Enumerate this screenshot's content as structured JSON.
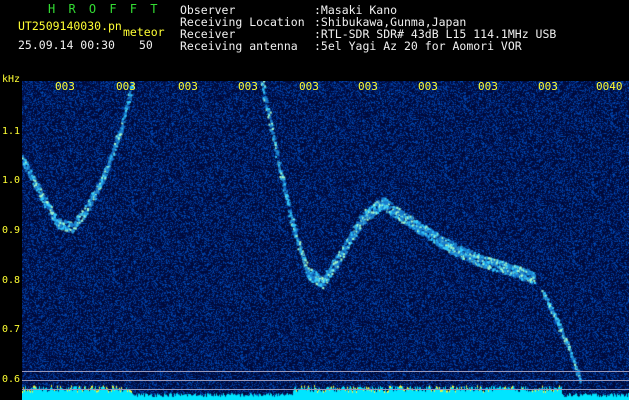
{
  "logo": {
    "text": "H R O F F T"
  },
  "file": {
    "name": "UT2509140030.pn",
    "type_label": "meteor",
    "datetime": "25.09.14 00:30",
    "count": "50"
  },
  "info": [
    {
      "label": "Observer",
      "value": ":Masaki Kano"
    },
    {
      "label": "Receiving Location",
      "value": ":Shibukawa,Gunma,Japan"
    },
    {
      "label": "Receiver",
      "value": ":RTL-SDR SDR# 43dB L15 114.1MHz USB"
    },
    {
      "label": "Receiving antenna",
      "value": ":5el Yagi Az 20 for Aomori VOR"
    }
  ],
  "axis": {
    "unit_label": "kHz",
    "y_ticks": [
      {
        "label": "1.1",
        "value": 1.1
      },
      {
        "label": "1.0",
        "value": 1.0
      },
      {
        "label": "0.9",
        "value": 0.9
      },
      {
        "label": "0.8",
        "value": 0.8
      },
      {
        "label": "0.7",
        "value": 0.7
      },
      {
        "label": "0.6",
        "value": 0.6
      }
    ],
    "x_ticks": [
      "003",
      "003",
      "003",
      "003",
      "003",
      "003",
      "003",
      "003",
      "003",
      "0040"
    ]
  },
  "colors": {
    "background": "#000000",
    "plot_bg": "#000a3a",
    "header_green": "#33dd33",
    "header_yellow": "#ffff33",
    "signal": "#33ccff",
    "level_bar": "#00e5ff",
    "level_peak": "#ffff33"
  }
}
